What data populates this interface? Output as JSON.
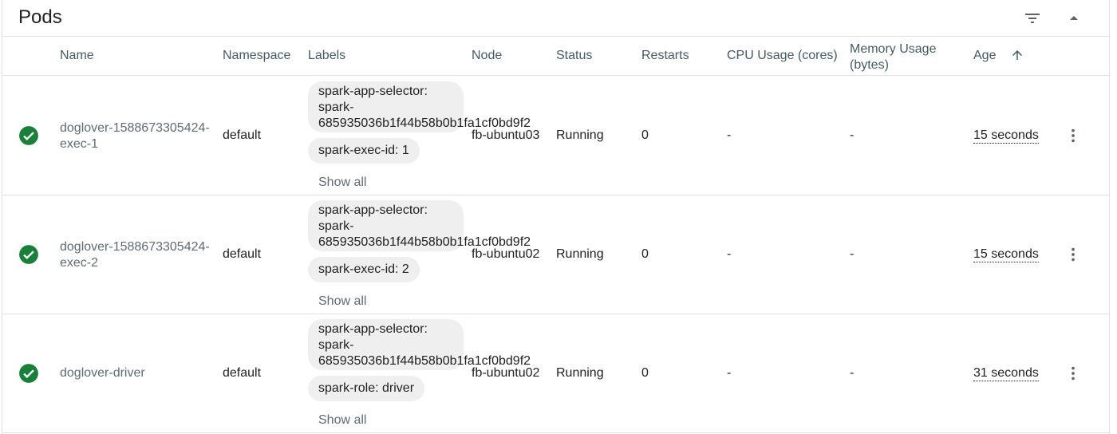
{
  "card": {
    "title": "Pods"
  },
  "columns": {
    "name": "Name",
    "namespace": "Namespace",
    "labels": "Labels",
    "node": "Node",
    "status": "Status",
    "restarts": "Restarts",
    "cpu": "CPU Usage (cores)",
    "memory_line1": "Memory Usage",
    "memory_line2": "(bytes)",
    "age": "Age"
  },
  "colors": {
    "success": "#188038",
    "link": "#5f6a73",
    "chip_bg": "#efefef",
    "header_text": "#455a64"
  },
  "rows": [
    {
      "name": "doglover-1588673305424-exec-1",
      "namespace": "default",
      "label1": "spark-app-selector: spark-685935036b1f44b58b0b1fa1cf0bd9f2",
      "label2": "spark-exec-id: 1",
      "show_all": "Show all",
      "node": "fb-ubuntu03",
      "status": "Running",
      "restarts": "0",
      "cpu": "-",
      "memory": "-",
      "age": "15 seconds"
    },
    {
      "name": "doglover-1588673305424-exec-2",
      "namespace": "default",
      "label1": "spark-app-selector: spark-685935036b1f44b58b0b1fa1cf0bd9f2",
      "label2": "spark-exec-id: 2",
      "show_all": "Show all",
      "node": "fb-ubuntu02",
      "status": "Running",
      "restarts": "0",
      "cpu": "-",
      "memory": "-",
      "age": "15 seconds"
    },
    {
      "name": "doglover-driver",
      "namespace": "default",
      "label1": "spark-app-selector: spark-685935036b1f44b58b0b1fa1cf0bd9f2",
      "label2": "spark-role: driver",
      "show_all": "Show all",
      "node": "fb-ubuntu02",
      "status": "Running",
      "restarts": "0",
      "cpu": "-",
      "memory": "-",
      "age": "31 seconds"
    }
  ]
}
